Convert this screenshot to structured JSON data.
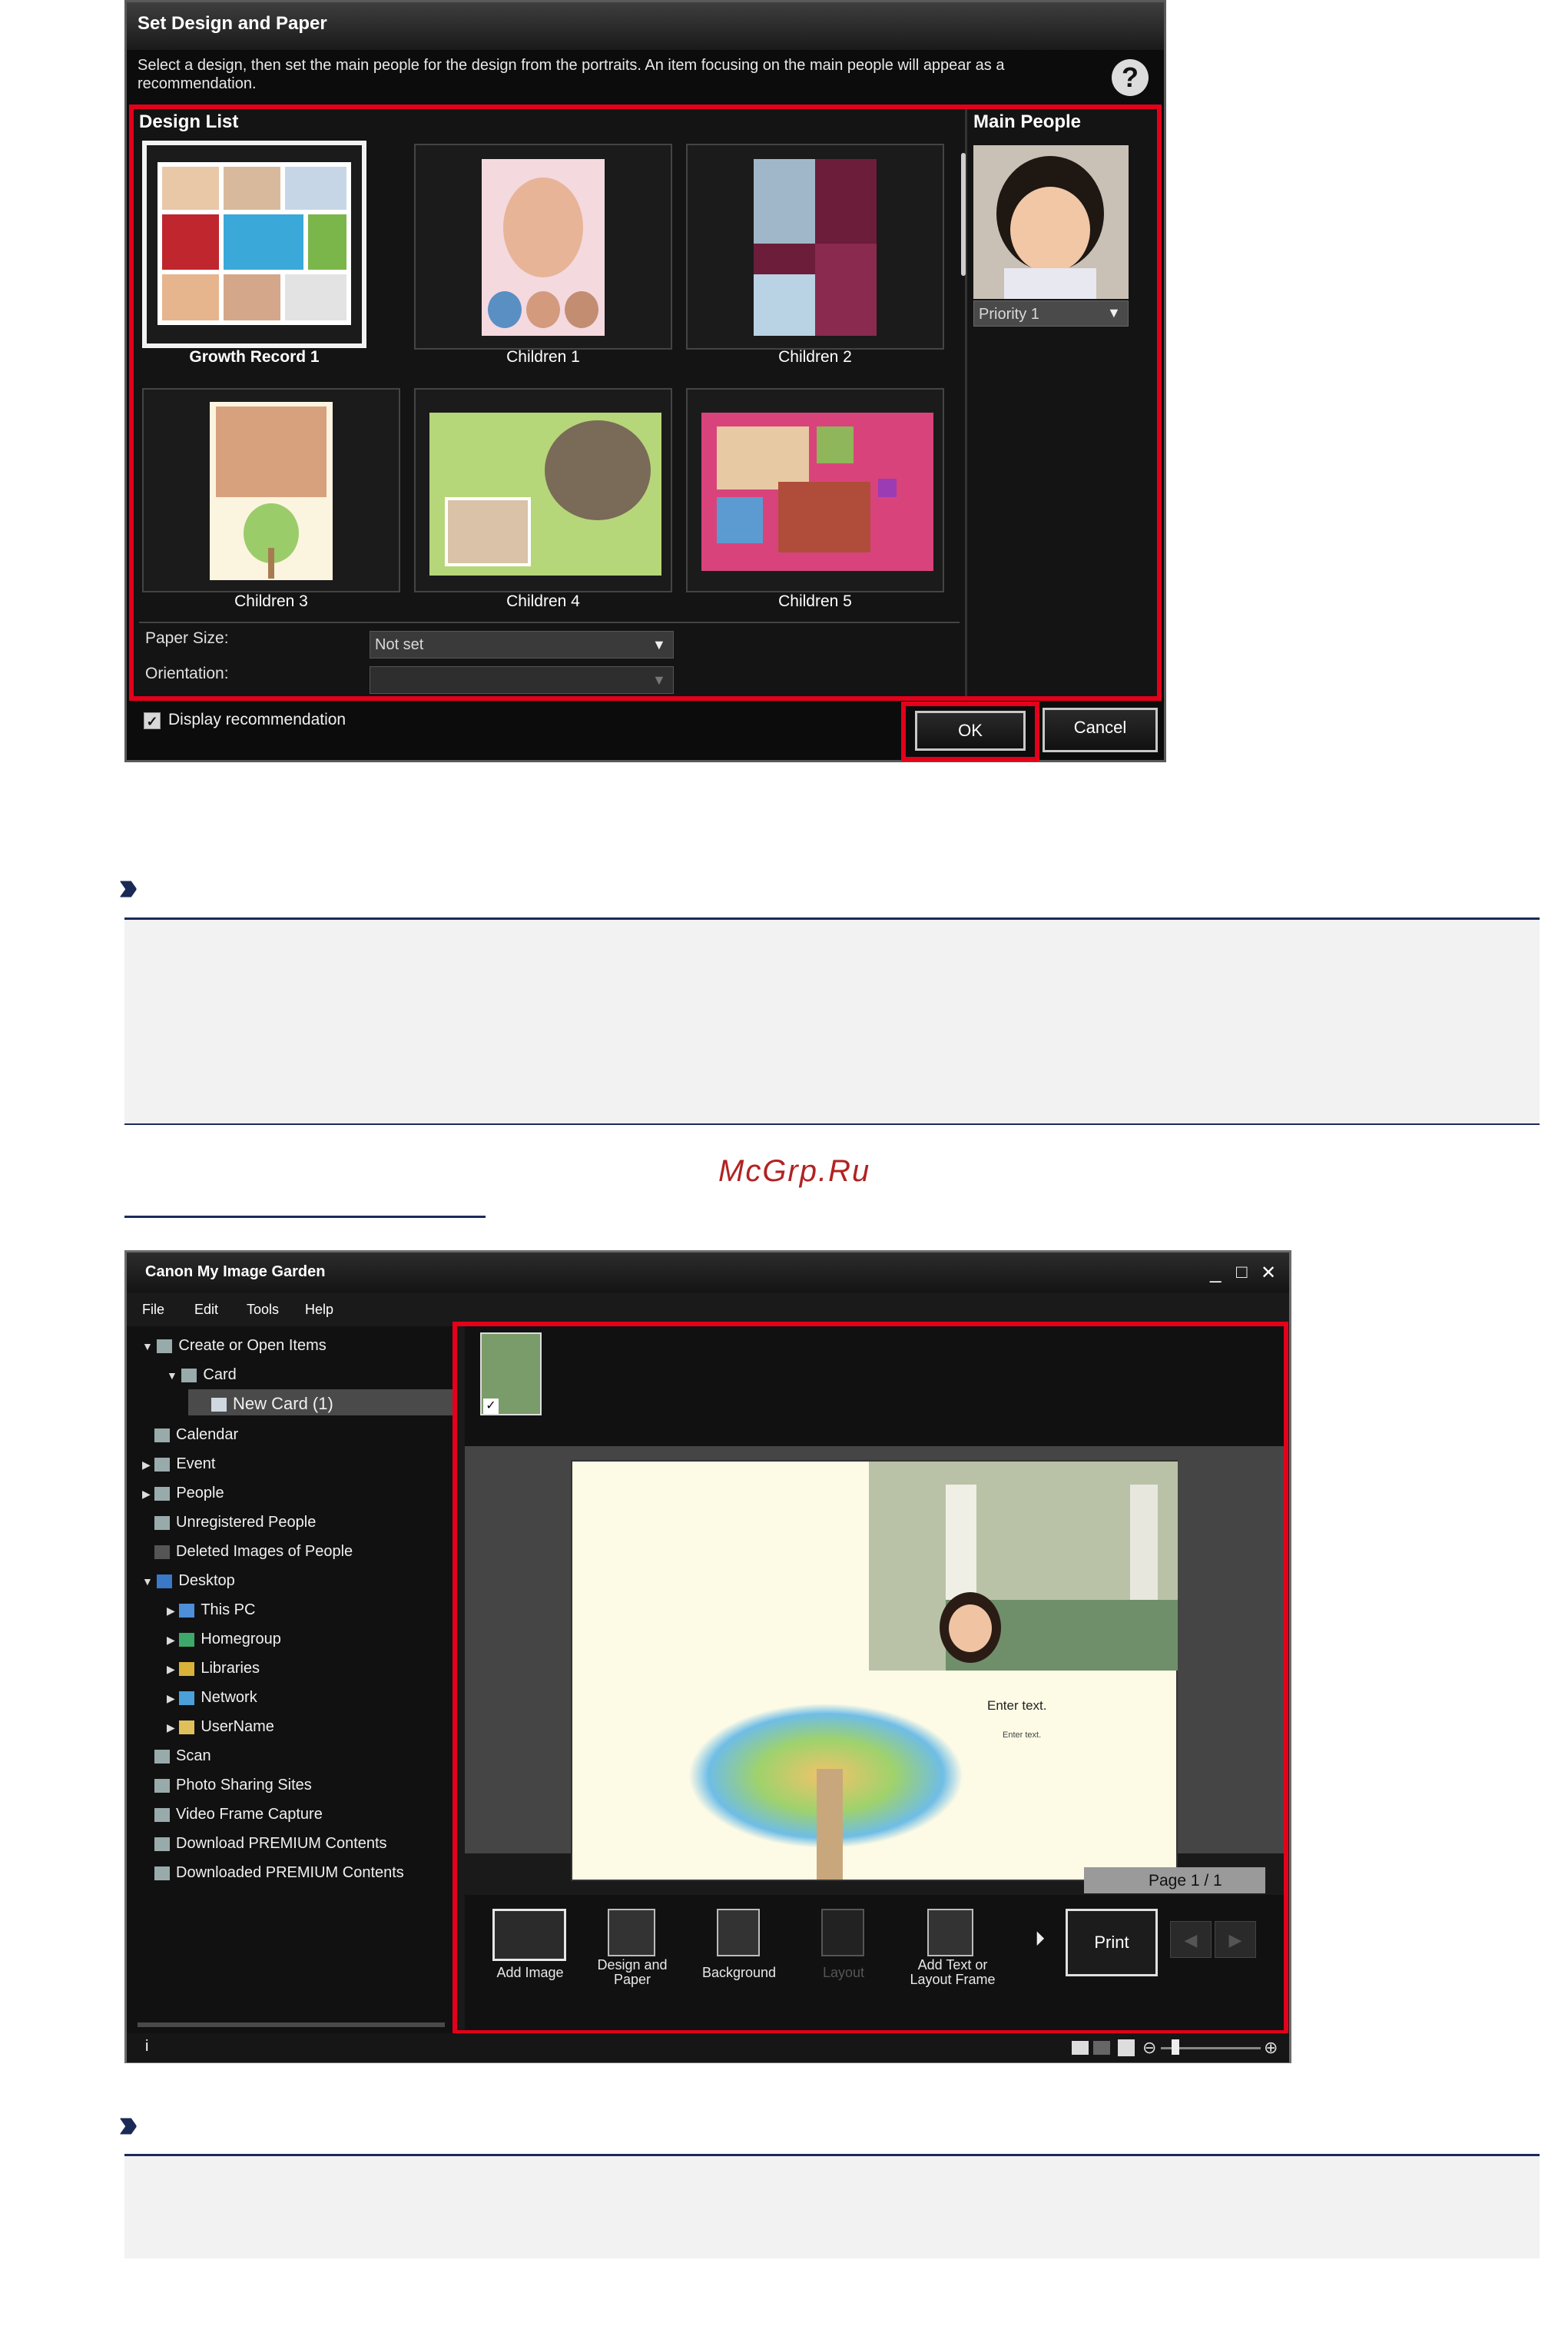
{
  "dialog": {
    "title": "Set Design and Paper",
    "description": "Select a design, then set the main people for the design from the portraits. An item focusing on the main people will appear as a recommendation.",
    "help_icon": "?",
    "design_list_heading": "Design List",
    "main_people_heading": "Main People",
    "designs": [
      {
        "label": "Growth Record 1",
        "selected": true
      },
      {
        "label": "Children 1",
        "selected": false
      },
      {
        "label": "Children 2",
        "selected": false
      },
      {
        "label": "Children 3",
        "selected": false
      },
      {
        "label": "Children 4",
        "selected": false
      },
      {
        "label": "Children 5",
        "selected": false
      }
    ],
    "priority_value": "Priority 1",
    "paper_size_label": "Paper Size:",
    "paper_size_value": "Not set",
    "orientation_label": "Orientation:",
    "orientation_value": "",
    "display_recommendation": "Display recommendation",
    "ok_label": "OK",
    "cancel_label": "Cancel"
  },
  "watermark": "McGrp.Ru",
  "app": {
    "title": "Canon My Image Garden",
    "window_controls": {
      "minimize": "_",
      "maximize": "□",
      "close": "✕"
    },
    "menu": [
      "File",
      "Edit",
      "Tools",
      "Help"
    ],
    "tree": [
      {
        "label": "Create or Open Items",
        "arrow": "▼"
      },
      {
        "label": "Card",
        "arrow": "▼"
      },
      {
        "label": "New Card (1)",
        "arrow": ""
      },
      {
        "label": "Calendar",
        "arrow": ""
      },
      {
        "label": "Event",
        "arrow": "▶"
      },
      {
        "label": "People",
        "arrow": "▶"
      },
      {
        "label": "Unregistered People",
        "arrow": ""
      },
      {
        "label": "Deleted Images of People",
        "arrow": ""
      },
      {
        "label": "Desktop",
        "arrow": "▼"
      },
      {
        "label": "This PC",
        "arrow": "▶"
      },
      {
        "label": "Homegroup",
        "arrow": "▶"
      },
      {
        "label": "Libraries",
        "arrow": "▶"
      },
      {
        "label": "Network",
        "arrow": "▶"
      },
      {
        "label": "UserName",
        "arrow": "▶"
      },
      {
        "label": "Scan",
        "arrow": ""
      },
      {
        "label": "Photo Sharing Sites",
        "arrow": ""
      },
      {
        "label": "Video Frame Capture",
        "arrow": ""
      },
      {
        "label": "Download PREMIUM Contents",
        "arrow": ""
      },
      {
        "label": "Downloaded PREMIUM Contents",
        "arrow": ""
      }
    ],
    "canvas_text_1": "Enter text.",
    "canvas_text_2": "Enter text.",
    "page_indicator": "Page 1 / 1",
    "toolbar": {
      "add_image": "Add Image",
      "design_paper_1": "Design and",
      "design_paper_2": "Paper",
      "background": "Background",
      "layout": "Layout",
      "add_text_1": "Add Text or",
      "add_text_2": "Layout Frame",
      "print": "Print"
    },
    "status_info": "i"
  }
}
